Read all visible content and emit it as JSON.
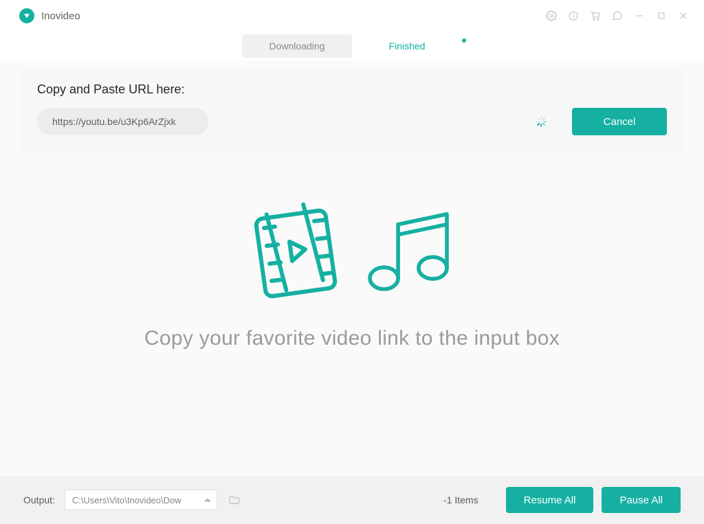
{
  "app": {
    "title": "Inovideo"
  },
  "tabs": {
    "downloading": "Downloading",
    "finished": "Finished"
  },
  "url_section": {
    "label": "Copy and Paste URL here:",
    "value": "https://youtu.be/u3Kp6ArZjxk",
    "cancel": "Cancel"
  },
  "center_hint": "Copy your favorite video link to the input box",
  "footer": {
    "output_label": "Output:",
    "output_path": "C:\\Users\\Vito\\Inovideo\\Dow",
    "items": "-1 Items",
    "resume": "Resume All",
    "pause": "Pause All"
  },
  "colors": {
    "accent": "#15b0a2"
  }
}
